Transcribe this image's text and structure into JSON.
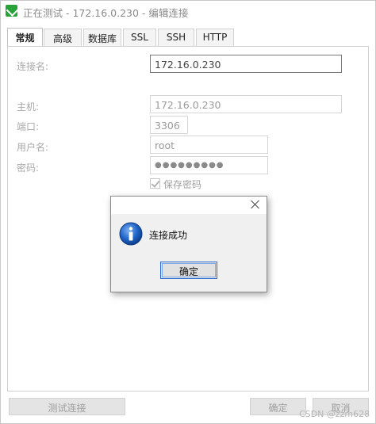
{
  "window": {
    "title": "正在测试 - 172.16.0.230 - 编辑连接"
  },
  "tabs": [
    {
      "label": "常规",
      "active": true
    },
    {
      "label": "高级"
    },
    {
      "label": "数据库"
    },
    {
      "label": "SSL"
    },
    {
      "label": "SSH"
    },
    {
      "label": "HTTP"
    }
  ],
  "form": {
    "connection_name_label": "连接名:",
    "connection_name_value": "172.16.0.230",
    "host_label": "主机:",
    "host_value": "172.16.0.230",
    "port_label": "端口:",
    "port_value": "3306",
    "username_label": "用户名:",
    "username_value": "root",
    "password_label": "密码:",
    "password_value": "●●●●●●●●●",
    "save_password_label": "保存密码",
    "save_password_checked": true
  },
  "buttons": {
    "test_connection": "测试连接",
    "ok": "确定",
    "cancel": "取消"
  },
  "dialog": {
    "message": "连接成功",
    "ok_label": "确定",
    "icon": "info-icon"
  },
  "watermark": "CSDN @zzm628",
  "colors": {
    "accent": "#2f6bd0",
    "app_icon": "#27a33a",
    "info_icon": "#1e63c4"
  }
}
